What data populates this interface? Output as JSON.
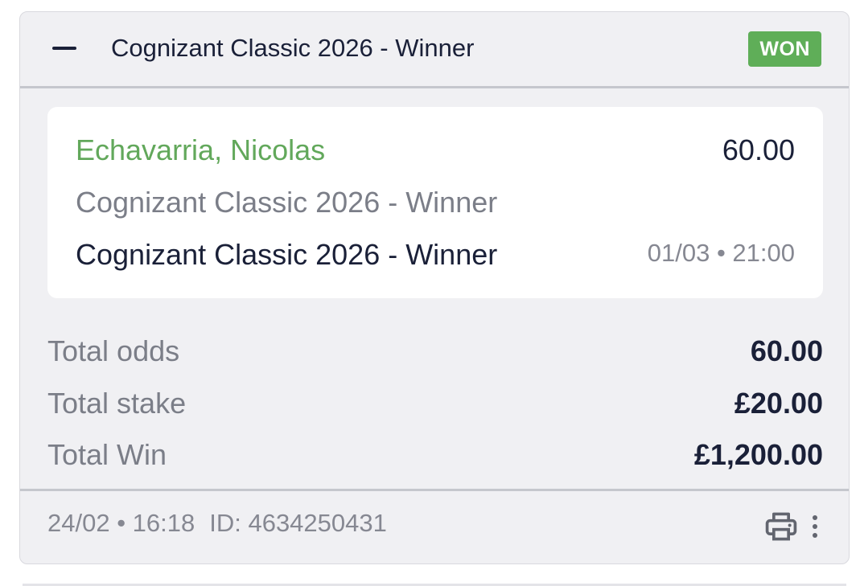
{
  "bet": {
    "header": {
      "title": "Cognizant Classic 2026 - Winner",
      "status": "WON",
      "status_color": "#5fae58"
    },
    "selection": {
      "name": "Echavarria, Nicolas",
      "odds": "60.00",
      "market": "Cognizant Classic 2026 - Winner",
      "event": "Cognizant Classic 2026 - Winner",
      "event_time": "01/03 • 21:00"
    },
    "totals": [
      {
        "label": "Total odds",
        "value": "60.00"
      },
      {
        "label": "Total stake",
        "value": "£20.00"
      },
      {
        "label": "Total Win",
        "value": "£1,200.00"
      }
    ],
    "footer": {
      "placed_at": "24/02 • 16:18",
      "id_text": "ID: 4634250431"
    },
    "icons": {
      "collapse": "minus-icon",
      "print": "printer-icon",
      "more": "more-vertical-icon"
    }
  }
}
